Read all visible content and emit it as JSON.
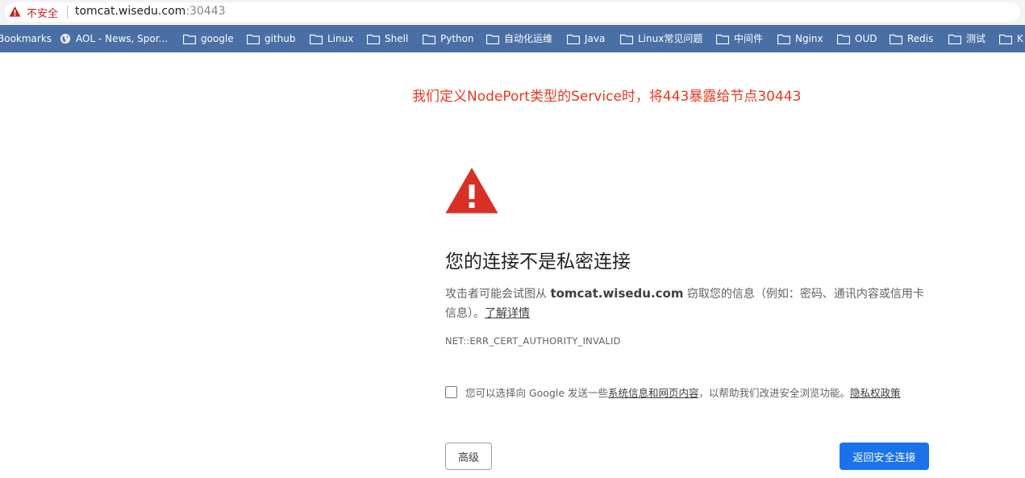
{
  "address_bar": {
    "security_label": "不安全",
    "url_host": "tomcat.wisedu.com",
    "url_port": ":30443"
  },
  "bookmarks": [
    {
      "label": "Bookmarks",
      "icon": "none"
    },
    {
      "label": "AOL - News, Spor...",
      "icon": "globe-icon"
    },
    {
      "label": "google",
      "icon": "folder-icon"
    },
    {
      "label": "github",
      "icon": "folder-icon"
    },
    {
      "label": "Linux",
      "icon": "folder-icon"
    },
    {
      "label": "Shell",
      "icon": "folder-icon"
    },
    {
      "label": "Python",
      "icon": "folder-icon"
    },
    {
      "label": "自动化运维",
      "icon": "folder-icon"
    },
    {
      "label": "Java",
      "icon": "folder-icon"
    },
    {
      "label": "Linux常见问题",
      "icon": "folder-icon"
    },
    {
      "label": "中间件",
      "icon": "folder-icon"
    },
    {
      "label": "Nginx",
      "icon": "folder-icon"
    },
    {
      "label": "OUD",
      "icon": "folder-icon"
    },
    {
      "label": "Redis",
      "icon": "folder-icon"
    },
    {
      "label": "测试",
      "icon": "folder-icon"
    },
    {
      "label": "K",
      "icon": "folder-icon"
    }
  ],
  "annotation": "我们定义NodePort类型的Service时，将443暴露给节点30443",
  "interstitial": {
    "heading": "您的连接不是私密连接",
    "desc_prefix": "攻击者可能会试图从 ",
    "desc_host": "tomcat.wisedu.com",
    "desc_suffix": " 窃取您的信息（例如：密码、通讯内容或信用卡信息）。",
    "learn_more": "了解详情",
    "error_code": "NET::ERR_CERT_AUTHORITY_INVALID",
    "optin_prefix": "您可以选择向 Google 发送一些",
    "optin_link": "系统信息和网页内容",
    "optin_middle": "，以帮助我们改进安全浏览功能。",
    "optin_privacy": "隐私权政策",
    "advanced_button": "高级",
    "back_button": "返回安全连接"
  },
  "colors": {
    "bookmarks_bar": "#4a6fa5",
    "warning_red": "#d93025",
    "annotation_red": "#e8391d",
    "primary_button": "#1a73e8"
  }
}
